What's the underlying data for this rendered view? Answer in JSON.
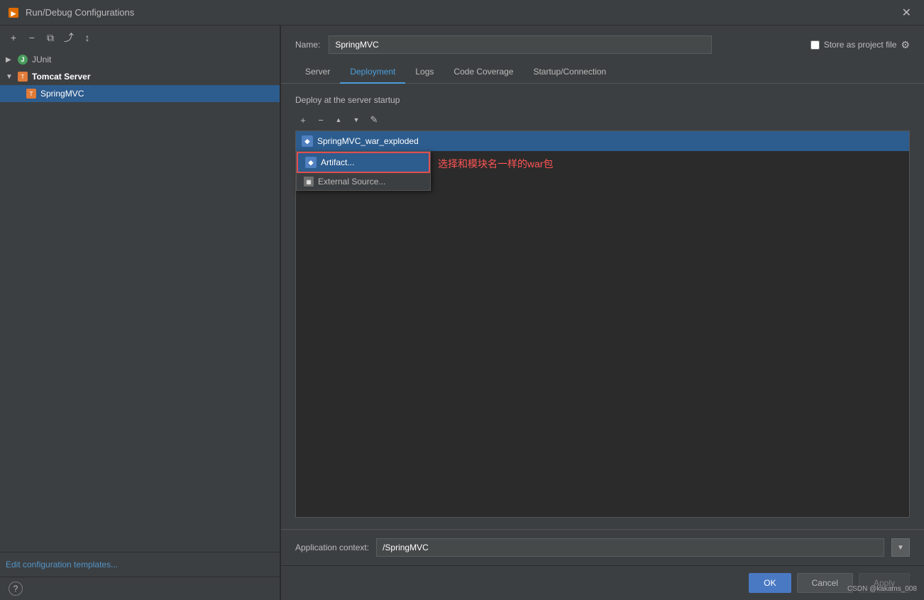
{
  "titleBar": {
    "title": "Run/Debug Configurations",
    "closeLabel": "✕"
  },
  "toolbar": {
    "addLabel": "+",
    "removeLabel": "−",
    "copyLabel": "⧉",
    "moveLabel": "⤴",
    "sortLabel": "↕"
  },
  "tree": {
    "junitItem": {
      "label": "JUnit",
      "icon": "J"
    },
    "tomcatGroup": {
      "label": "Tomcat Server",
      "icon": "T"
    },
    "springMvcItem": {
      "label": "SpringMVC",
      "icon": "T"
    }
  },
  "footer": {
    "editTemplatesLink": "Edit configuration templates..."
  },
  "rightPanel": {
    "nameLabel": "Name:",
    "nameValue": "SpringMVC",
    "storeLabel": "Store as project file",
    "tabs": [
      {
        "label": "Server",
        "active": false
      },
      {
        "label": "Deployment",
        "active": true
      },
      {
        "label": "Logs",
        "active": false
      },
      {
        "label": "Code Coverage",
        "active": false
      },
      {
        "label": "Startup/Connection",
        "active": false
      }
    ],
    "deployLabel": "Deploy at the server startup",
    "deployToolbar": {
      "add": "+",
      "remove": "−",
      "up": "▲",
      "down": "▼",
      "edit": "✎"
    },
    "deployedItem": "SpringMVC_war_exploded",
    "dropdown": {
      "items": [
        {
          "label": "Artifact...",
          "icon": "◆",
          "highlighted": true
        },
        {
          "label": "External Source...",
          "icon": "▦"
        }
      ]
    },
    "annotation": "选择和模块名一样的war包",
    "appContextLabel": "Application context:",
    "appContextValue": "/SpringMVC",
    "buttons": {
      "ok": "OK",
      "cancel": "Cancel",
      "apply": "Apply"
    }
  },
  "watermark": "CSDN @kakams_008"
}
